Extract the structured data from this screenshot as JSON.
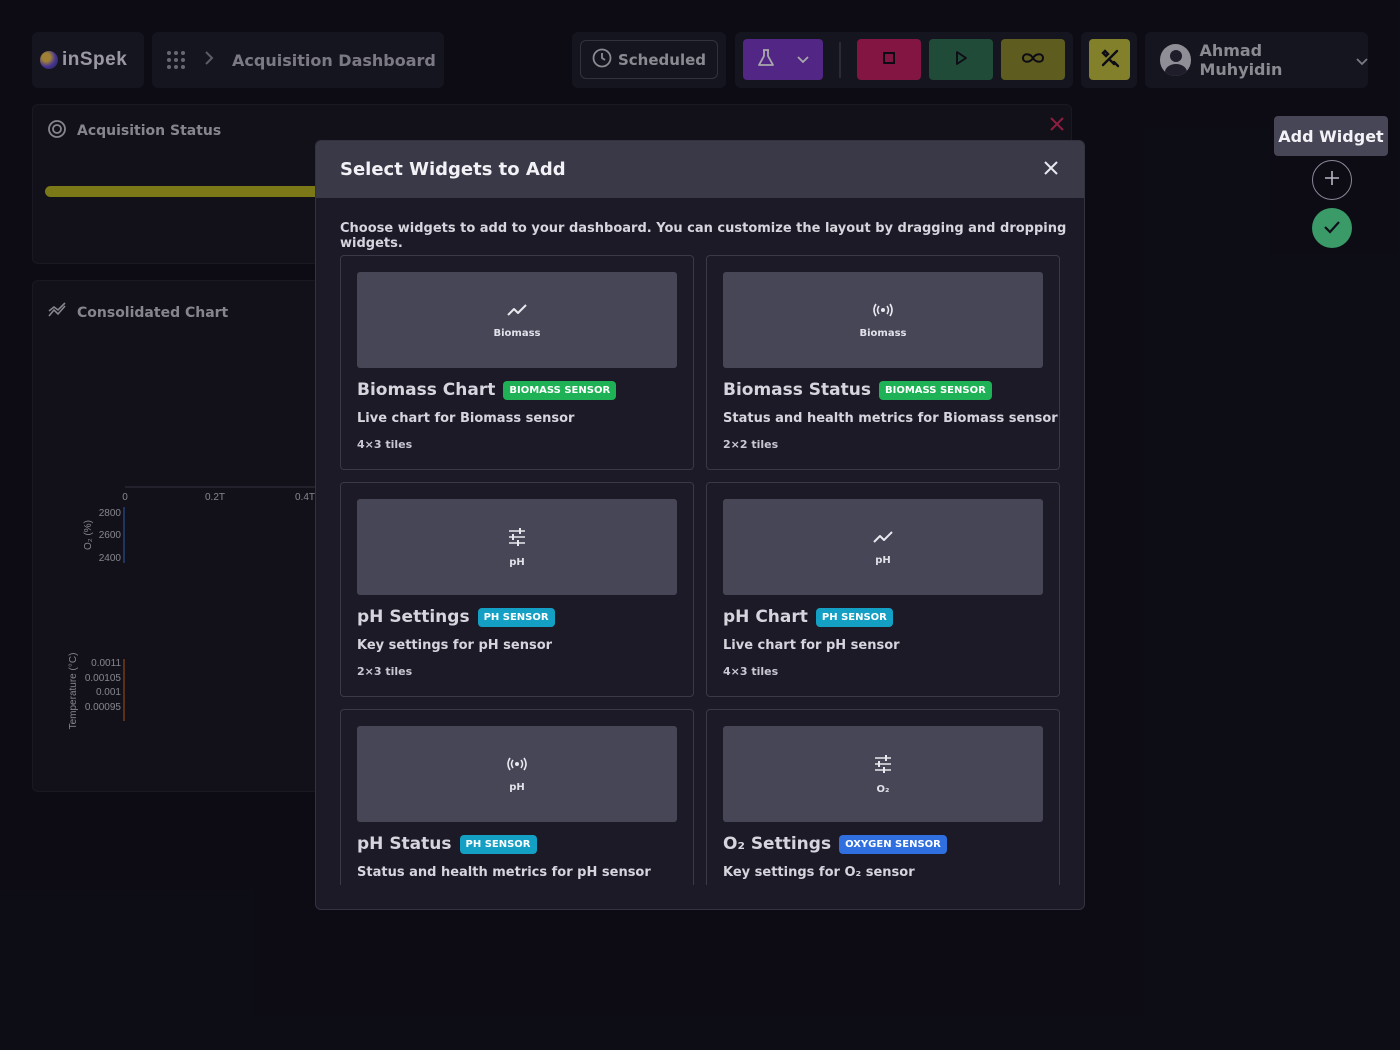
{
  "brand": {
    "name": "inSpek"
  },
  "breadcrumb": {
    "title": "Acquisition Dashboard"
  },
  "toolbar": {
    "scheduled_label": "Scheduled"
  },
  "user": {
    "name": "Ahmad Muhyidin"
  },
  "panels": {
    "acquisition_title": "Acquisition Status",
    "acquisition_progress": 0.27,
    "consolidated_title": "Consolidated Chart"
  },
  "consolidated_chart": {
    "x_ticks": [
      "0",
      "0.2T",
      "0.4T"
    ],
    "o2_axis_label": "O₂ (%)",
    "o2_ticks": [
      "2800",
      "2600",
      "2400"
    ],
    "temp_axis_label": "Temperature (°C)",
    "temp_ticks": [
      "0.0011",
      "0.00105",
      "0.001",
      "0.00095"
    ]
  },
  "modal": {
    "title": "Select Widgets to Add",
    "description": "Choose widgets to add to your dashboard. You can customize the layout by dragging and dropping widgets.",
    "widgets": [
      {
        "name": "Biomass Chart",
        "badge": "Biomass Sensor",
        "badge_color": "green",
        "preview_icon": "chart-line-icon",
        "preview_label": "Biomass",
        "description": "Live chart for Biomass sensor",
        "tiles": "4×3 tiles"
      },
      {
        "name": "Biomass Status",
        "badge": "Biomass Sensor",
        "badge_color": "green",
        "preview_icon": "broadcast-icon",
        "preview_label": "Biomass",
        "description": "Status and health metrics for Biomass sensor",
        "tiles": "2×2 tiles"
      },
      {
        "name": "pH Settings",
        "badge": "pH Sensor",
        "badge_color": "cyan",
        "preview_icon": "sliders-icon",
        "preview_label": "pH",
        "description": "Key settings for pH sensor",
        "tiles": "2×3 tiles"
      },
      {
        "name": "pH Chart",
        "badge": "pH Sensor",
        "badge_color": "cyan",
        "preview_icon": "chart-line-icon",
        "preview_label": "pH",
        "description": "Live chart for pH sensor",
        "tiles": "4×3 tiles"
      },
      {
        "name": "pH Status",
        "badge": "pH Sensor",
        "badge_color": "cyan",
        "preview_icon": "broadcast-icon",
        "preview_label": "pH",
        "description": "Status and health metrics for pH sensor",
        "tiles": ""
      },
      {
        "name": "O₂ Settings",
        "badge": "Oxygen Sensor",
        "badge_color": "blue",
        "preview_icon": "sliders-icon",
        "preview_label": "O₂",
        "description": "Key settings for O₂ sensor",
        "tiles": ""
      }
    ]
  },
  "side": {
    "tooltip": "Add Widget"
  },
  "colors": {
    "accent_purple": "#7a37c4",
    "stop_red": "#c41d5c",
    "play_green": "#2f6f50",
    "loop_olive": "#8c8a28",
    "tools_yellow": "#c4c03a",
    "progress_yellow": "#b8b41e",
    "badge_green": "#1fb155",
    "badge_cyan": "#13a0c4",
    "badge_blue": "#2f6fe0"
  }
}
